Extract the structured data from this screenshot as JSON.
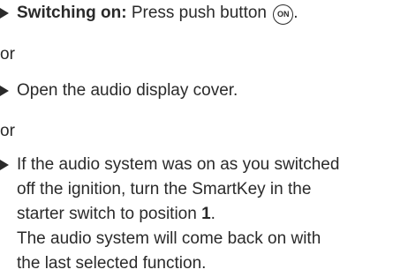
{
  "steps": [
    {
      "label": "Switching on:",
      "text": " Press push button ",
      "button_label": "ON",
      "after_button": "."
    },
    {
      "text": "Open the audio display cover."
    },
    {
      "lines": [
        "If the audio system was on as you switched",
        "off the ignition, turn the SmartKey in the",
        "starter switch to position "
      ],
      "position_value": "1",
      "after_position": ".",
      "result_lines": [
        "The audio system will come back on with",
        "the last selected function."
      ]
    }
  ],
  "or_1": "or",
  "or_2": "or"
}
